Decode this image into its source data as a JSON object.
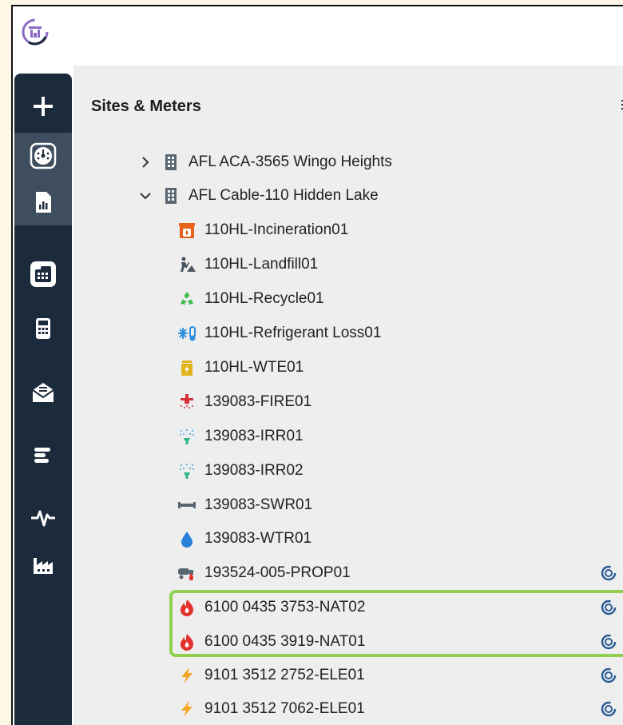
{
  "app": {
    "logo_icon": "app-logo-icon"
  },
  "sidebar": {
    "items": [
      {
        "name": "add",
        "icon": "plus-icon"
      },
      {
        "name": "dashboard",
        "icon": "dashboard-gauge-icon"
      },
      {
        "name": "reports",
        "icon": "report-chart-icon"
      },
      {
        "name": "sites-meters",
        "icon": "building-grid-icon",
        "active": true
      },
      {
        "name": "calculator",
        "icon": "calculator-icon"
      },
      {
        "name": "inbox",
        "icon": "mail-envelope-icon"
      },
      {
        "name": "gantt",
        "icon": "bars-icon"
      },
      {
        "name": "activity",
        "icon": "pulse-icon"
      },
      {
        "name": "facilities",
        "icon": "factory-icon"
      }
    ]
  },
  "panel": {
    "title": "Sites & Meters"
  },
  "tree": {
    "sites": [
      {
        "label": "AFL ACA-3565 Wingo Heights",
        "expanded": false
      },
      {
        "label": "AFL Cable-110 Hidden Lake",
        "expanded": true
      }
    ],
    "meters": [
      {
        "label": "110HL-Incineration01",
        "icon": "incineration-icon",
        "has_cost_icon": false
      },
      {
        "label": "110HL-Landfill01",
        "icon": "landfill-icon",
        "has_cost_icon": false
      },
      {
        "label": "110HL-Recycle01",
        "icon": "recycle-icon",
        "has_cost_icon": false
      },
      {
        "label": "110HL-Refrigerant Loss01",
        "icon": "refrigerant-icon",
        "has_cost_icon": false
      },
      {
        "label": "110HL-WTE01",
        "icon": "waste-to-energy-icon",
        "has_cost_icon": false
      },
      {
        "label": "139083-FIRE01",
        "icon": "fire-sprinkler-icon",
        "has_cost_icon": false
      },
      {
        "label": "139083-IRR01",
        "icon": "irrigation-icon",
        "has_cost_icon": false
      },
      {
        "label": "139083-IRR02",
        "icon": "irrigation-icon",
        "has_cost_icon": false
      },
      {
        "label": "139083-SWR01",
        "icon": "sewer-pipe-icon",
        "has_cost_icon": false
      },
      {
        "label": "139083-WTR01",
        "icon": "water-drop-icon",
        "has_cost_icon": false
      },
      {
        "label": "193524-005-PROP01",
        "icon": "propane-truck-icon",
        "has_cost_icon": true
      },
      {
        "label": "6100 0435 3753-NAT02",
        "icon": "natural-gas-flame-icon",
        "has_cost_icon": true
      },
      {
        "label": "6100 0435 3919-NAT01",
        "icon": "natural-gas-flame-icon",
        "has_cost_icon": true
      },
      {
        "label": "9101 3512 2752-ELE01",
        "icon": "electric-bolt-icon",
        "has_cost_icon": true
      },
      {
        "label": "9101 3512 7062-ELE01",
        "icon": "electric-bolt-icon",
        "has_cost_icon": true
      }
    ]
  },
  "colors": {
    "sidebar_bg": "#1c2b3c",
    "highlight_border": "#8fd14f",
    "flame": "#e3312d",
    "bolt": "#f5a623",
    "water": "#2a7fd8",
    "cost_icon": "#2a5d95"
  }
}
